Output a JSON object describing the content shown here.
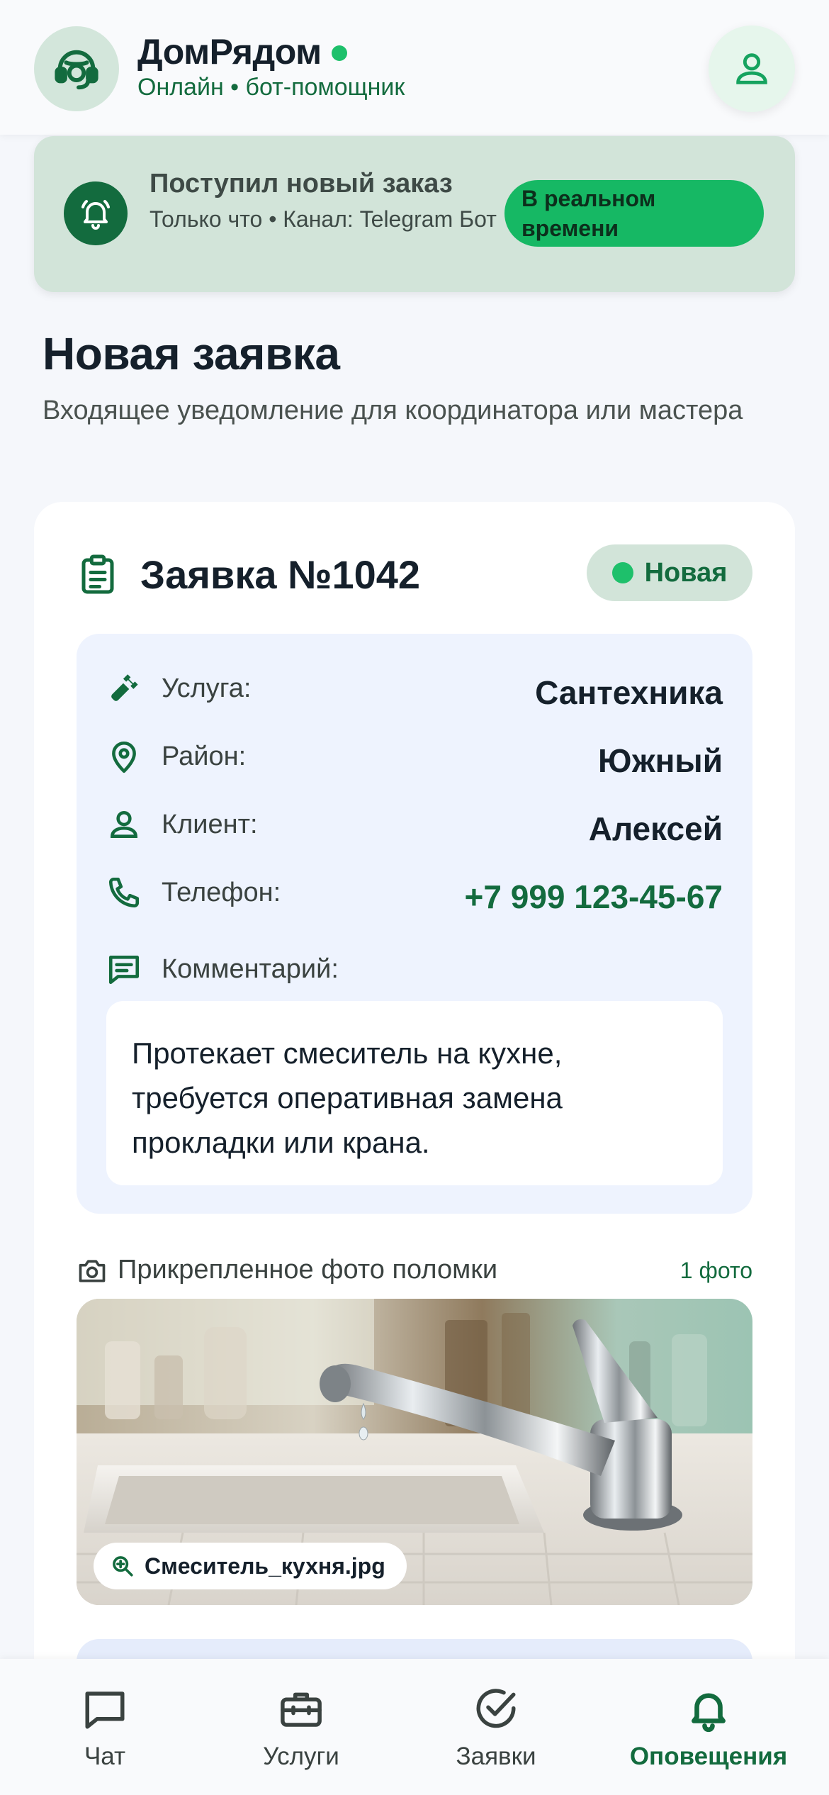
{
  "header": {
    "app_name": "ДомРядом",
    "subtitle": "Онлайн • бот-помощник",
    "brand_icon": "headset-agent-icon",
    "profile_icon": "user-icon"
  },
  "banner": {
    "title": "Поступил новый заказ",
    "meta": "Только что • Канал: Telegram Бот",
    "pill": "В реальном времени",
    "icon": "bell-ringing-icon"
  },
  "page": {
    "title": "Новая заявка",
    "subtitle": "Входящее уведомление для координатора или мастера"
  },
  "order": {
    "title": "Заявка №1042",
    "status": "Новая",
    "details": [
      {
        "icon": "wrench-icon",
        "label": "Услуга:",
        "value": "Сантехника"
      },
      {
        "icon": "location-pin-icon",
        "label": "Район:",
        "value": "Южный"
      },
      {
        "icon": "user-icon",
        "label": "Клиент:",
        "value": "Алексей"
      },
      {
        "icon": "phone-icon",
        "label": "Телефон:",
        "value": "+7 999 123-45-67"
      }
    ],
    "comment_label": "Комментарий:",
    "comment_text": "Протекает смеситель на кухне, требуется оперативная замена прокладки или крана.",
    "photo_label": "Прикрепленное фото поломки",
    "photo_count": "1 фото",
    "photo_filename": "Смеситель_кухня.jpg"
  },
  "nav": {
    "items": [
      {
        "label": "Чат",
        "icon": "chat-icon"
      },
      {
        "label": "Услуги",
        "icon": "toolbox-icon"
      },
      {
        "label": "Заявки",
        "icon": "check-circle-icon"
      },
      {
        "label": "Оповещения",
        "icon": "bell-icon"
      }
    ],
    "active_index": 3
  },
  "colors": {
    "brand_green": "#136b3e",
    "accent_green": "#1ec06b",
    "banner_bg": "#d2e4d9",
    "panel_bg": "#eef3fe"
  }
}
